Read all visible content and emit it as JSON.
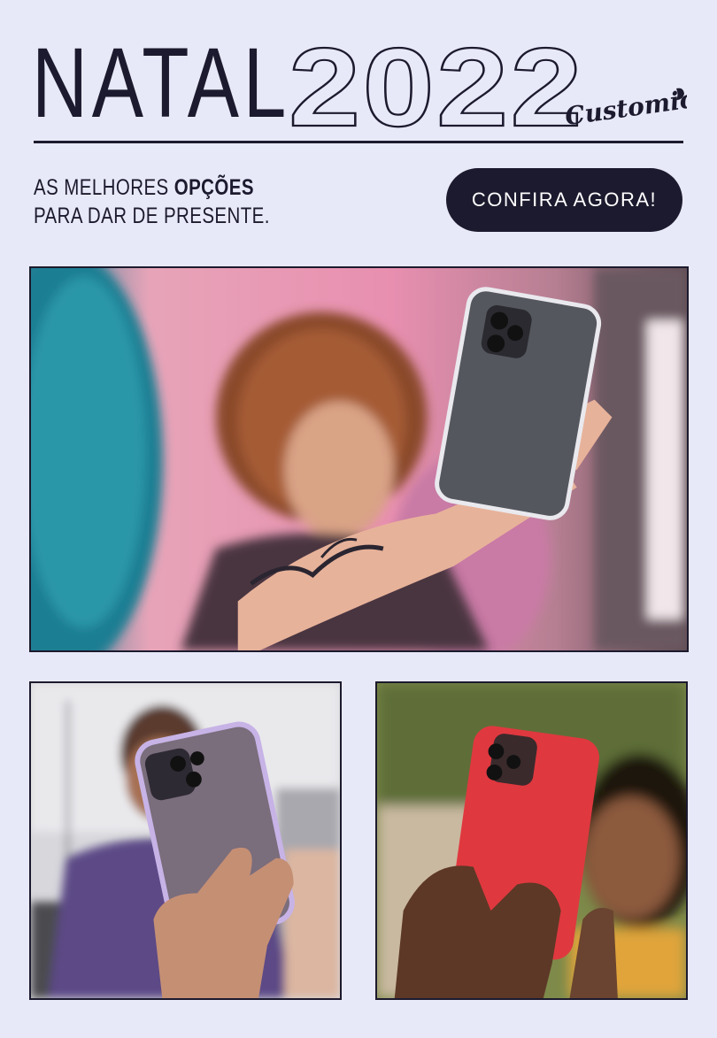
{
  "header": {
    "title_word": "NATAL",
    "title_year": "2022",
    "logo_text": "Customic"
  },
  "promo": {
    "line1_prefix": "AS MELHORES ",
    "line1_bold": "OPÇÕES",
    "line2": "PARA DAR DE PRESENTE.",
    "cta_label": "CONFIRA AGORA!"
  },
  "colors": {
    "background": "#e8e9f8",
    "ink": "#1c1a2e",
    "cta_text": "#ffffff"
  },
  "photos": [
    {
      "name": "selfie-clear-case",
      "icon": "photo-woman-clear-case"
    },
    {
      "name": "selfie-lilac-case",
      "icon": "photo-man-lilac-case"
    },
    {
      "name": "selfie-red-case",
      "icon": "photo-woman-red-case"
    }
  ]
}
